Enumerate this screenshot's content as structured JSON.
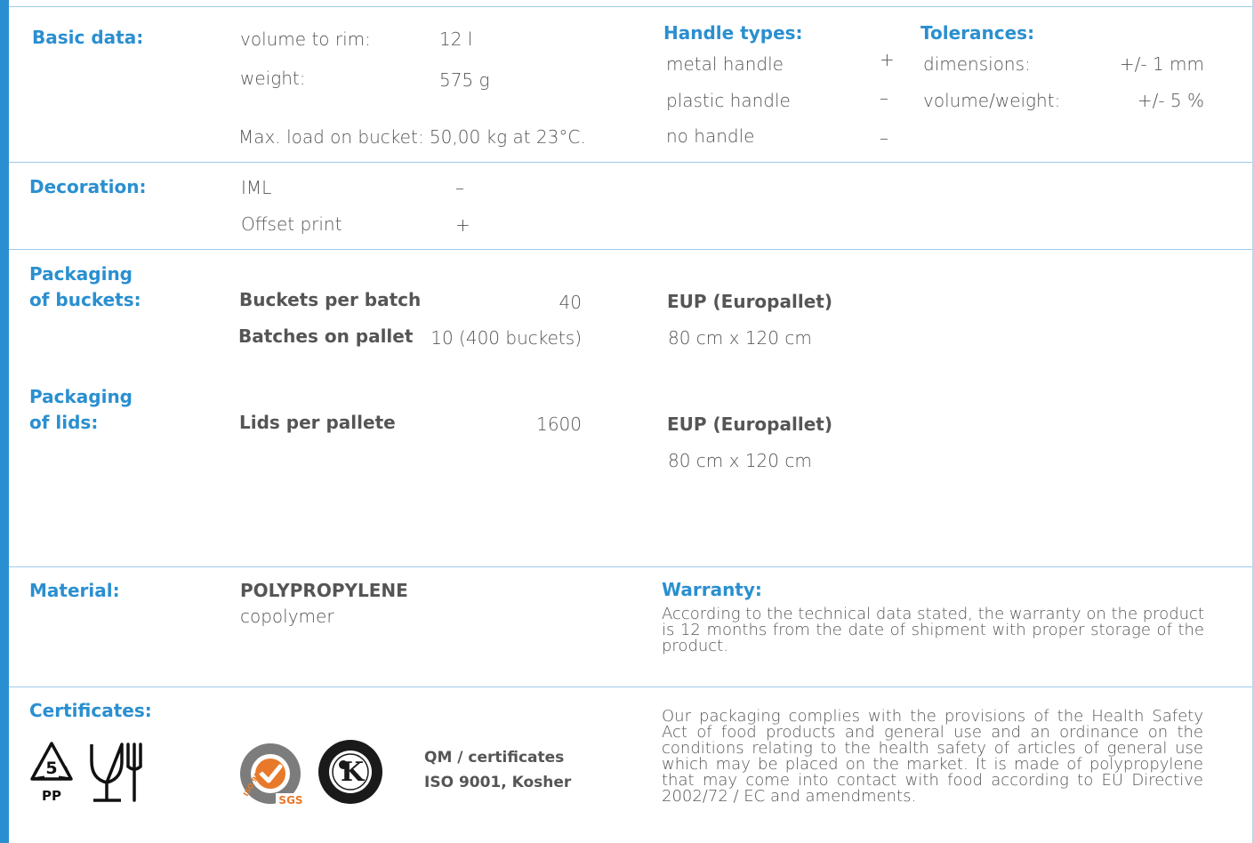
{
  "basic": {
    "label": "Basic data:",
    "volume_label": "volume to rim:",
    "volume_value": "12 l",
    "weight_label": "weight:",
    "weight_value": "575 g",
    "max_load": "Max. load on bucket: 50,00 kg at 23°C."
  },
  "handles": {
    "title": "Handle types:",
    "items": [
      {
        "name": "metal handle",
        "mark": "+"
      },
      {
        "name": "plastic handle",
        "mark": "–"
      },
      {
        "name": "no handle",
        "mark": "–"
      }
    ]
  },
  "tolerances": {
    "title": "Tolerances:",
    "dimensions_label": "dimensions:",
    "dimensions_value": "+/- 1 mm",
    "volume_label": "volume/weight:",
    "volume_value": "+/- 5 %"
  },
  "decoration": {
    "label": "Decoration:",
    "items": [
      {
        "name": "IML",
        "mark": "–"
      },
      {
        "name": "Offset print",
        "mark": "+"
      }
    ]
  },
  "buckets": {
    "label_line1": "Packaging",
    "label_line2": "of buckets:",
    "per_batch_label": "Buckets per batch",
    "per_batch_value": "40",
    "batches_label": "Batches on pallet",
    "batches_value": "10 (400 buckets)",
    "pallet_title": "EUP (Europallet)",
    "pallet_size": "80 cm x 120 cm"
  },
  "lids": {
    "label_line1": "Packaging",
    "label_line2": "of lids:",
    "per_pallet_label": "Lids per pallete",
    "per_pallet_value": "1600",
    "pallet_title": "EUP (Europallet)",
    "pallet_size": "80 cm x 120 cm"
  },
  "material": {
    "label": "Material:",
    "name": "POLYPROPYLENE",
    "sub": "copolymer"
  },
  "warranty": {
    "title": "Warranty:",
    "text": "According to the technical data stated, the warranty on the product is 12 months from the date of shipment with proper storage of the product."
  },
  "certificates": {
    "label": "Certificates:",
    "recycle_number": "5",
    "recycle_code": "PP",
    "sgs_text": "SGS",
    "iso_text": "ISO 9001",
    "kosher_letter": "K",
    "qm_line1": "QM / certificates",
    "qm_line2": "ISO 9001, Kosher",
    "compliance_text": "Our packaging complies with the provisions of the Health Safety Act of food products and general use and an ordinance on the conditions relating to the health safety of articles of general use which may be placed on the market. It is made of polypropylene that may come into contact with food according to EU Directive 2002/72 / EC and amendments."
  },
  "colors": {
    "accent": "#2a8fd0",
    "rule": "#9fcbe8",
    "text": "#555555"
  }
}
